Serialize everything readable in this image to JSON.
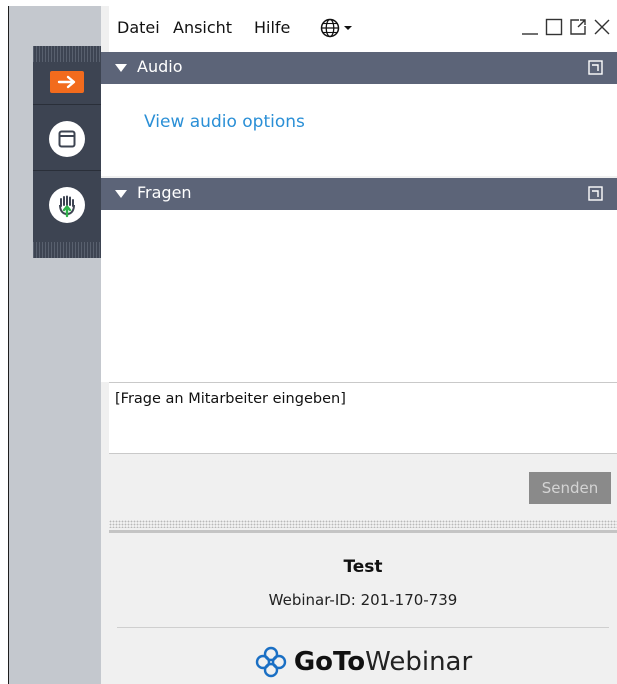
{
  "menu": {
    "file": "Datei",
    "view": "Ansicht",
    "help": "Hilfe"
  },
  "audio_panel": {
    "title": "Audio",
    "link": "View audio options"
  },
  "questions_panel": {
    "title": "Fragen",
    "input_placeholder": "[Frage an Mitarbeiter eingeben]",
    "send_label": "Senden"
  },
  "session": {
    "title": "Test",
    "webinar_id": "Webinar-ID: 201-170-739"
  },
  "brand": {
    "bold": "GoTo",
    "regular": "Webinar"
  },
  "colors": {
    "toolbar": "#3d4452",
    "header": "#5c6478",
    "accent_orange": "#f26b1d",
    "link": "#2a8fd6",
    "logo_blue": "#1a6fc4"
  },
  "icons": [
    "globe-icon",
    "minimize-icon",
    "maximize-icon",
    "popout-icon",
    "close-icon",
    "arrow-right-icon",
    "window-icon",
    "raise-hand-icon",
    "goto-logo-icon"
  ]
}
